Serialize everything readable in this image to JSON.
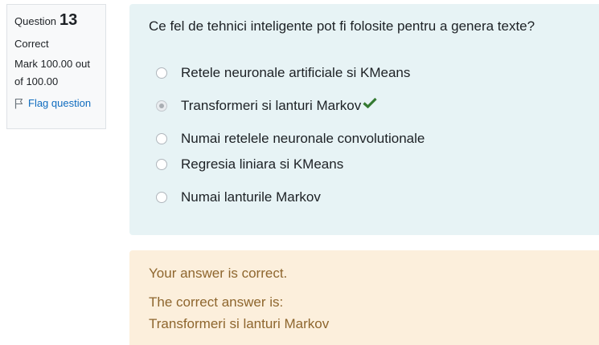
{
  "info": {
    "question_label": "Question",
    "question_number": "13",
    "state": "Correct",
    "grade_line1": "Mark 100.00 out",
    "grade_line2": "of 100.00",
    "flag_label": "Flag question"
  },
  "question": {
    "text": "Ce fel de tehnici inteligente pot fi folosite pentru a genera texte?",
    "options": [
      {
        "label": "Retele neuronale artificiale si KMeans",
        "selected": false
      },
      {
        "label": "Transformeri si lanturi Markov",
        "selected": true,
        "correct_mark": true
      },
      {
        "label": "Numai retelele neuronale convolutionale",
        "selected": false
      },
      {
        "label": "Regresia liniara si KMeans",
        "selected": false
      },
      {
        "label": "Numai lanturile Markov",
        "selected": false
      }
    ]
  },
  "feedback": {
    "result": "Your answer is correct.",
    "right_answer_label": "The correct answer is:",
    "right_answer": "Transformeri si lanturi Markov"
  },
  "colors": {
    "formulation_bg": "#e7f3f5",
    "outcome_bg": "#fcefdc",
    "outcome_text": "#8e662e",
    "link": "#0f6cbf",
    "check": "#357a32"
  }
}
